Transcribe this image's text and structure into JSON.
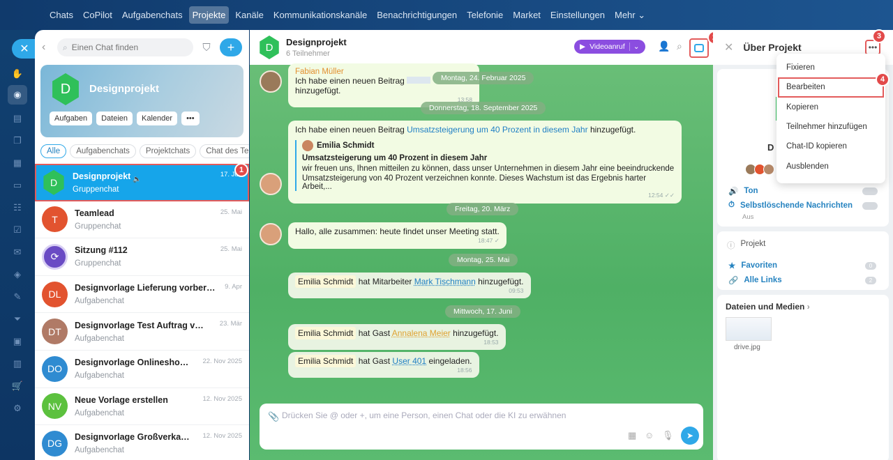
{
  "topnav": [
    "Chats",
    "CoPilot",
    "Aufgabenchats",
    "Projekte",
    "Kanäle",
    "Kommunikationskanäle",
    "Benachrichtigungen",
    "Telefonie",
    "Market",
    "Einstellungen",
    "Mehr ⌄"
  ],
  "sidebar": {
    "search_placeholder": "Einen Chat finden",
    "project": {
      "avatar_letter": "D",
      "name": "Designprojekt",
      "buttons": [
        "Aufgaben",
        "Dateien",
        "Kalender",
        "•••"
      ]
    },
    "filters": [
      "Alle",
      "Aufgabenchats",
      "Projektchats",
      "Chat des Te"
    ],
    "chats": [
      {
        "initials": "D",
        "title": "Designprojekt",
        "subtitle": "Gruppenchat",
        "date": "17. Jun",
        "color": "#2fc05a"
      },
      {
        "initials": "T",
        "title": "Teamlead",
        "subtitle": "Gruppenchat",
        "date": "25. Mai",
        "color": "#e2532f"
      },
      {
        "initials": "",
        "title": "Sitzung #112",
        "subtitle": "Gruppenchat",
        "date": "25. Mai",
        "color": "#6a4bc4"
      },
      {
        "initials": "DL",
        "title": "Designvorlage Lieferung vorbereiten",
        "subtitle": "Aufgabenchat",
        "date": "9. Apr",
        "color": "#e2532f"
      },
      {
        "initials": "DT",
        "title": "Designvorlage Test Auftrag vorbe...",
        "subtitle": "Aufgabenchat",
        "date": "23. Mär",
        "color": "#b07a66"
      },
      {
        "initials": "DO",
        "title": "Designvorlage Onlineshopbe...",
        "subtitle": "Aufgabenchat",
        "date": "22. Nov 2025",
        "color": "#2f8bd1"
      },
      {
        "initials": "NV",
        "title": "Neue Vorlage erstellen",
        "subtitle": "Aufgabenchat",
        "date": "12. Nov 2025",
        "color": "#5cc13e"
      },
      {
        "initials": "DG",
        "title": "Designvorlage Großverkauf v...",
        "subtitle": "Aufgabenchat",
        "date": "12. Nov 2025",
        "color": "#2f8bd1"
      }
    ]
  },
  "chat": {
    "title": "Designprojekt",
    "subtitle": "6 Teilnehmer",
    "avatar_letter": "D",
    "video_label": "Videoanruf",
    "msg1": {
      "author": "Fabian Müller",
      "text_a": "Ich habe einen neuen Beitrag",
      "text_b": "hinzugefügt.",
      "time": "13:58"
    },
    "date1": "Montag, 24. Februar 2025",
    "date2": "Donnerstag, 18. September 2025",
    "msg2": {
      "text_a": "Ich habe einen neuen Beitrag",
      "link": "Umsatzsteigerung um 40 Prozent in diesem Jahr",
      "text_b": "hinzugefügt.",
      "quote_author": "Emilia Schmidt",
      "quote_title": "Umsatzsteigerung um 40 Prozent in diesem Jahr",
      "quote_line1": "wir freuen uns, Ihnen mitteilen zu können, dass unser Unternehmen in diesem Jahr eine beeindruckende",
      "quote_line2": "Umsatzsteigerung von 40 Prozent verzeichnen konnte. Dieses Wachstum ist das Ergebnis harter Arbeit,...",
      "time": "12:54 ✓✓"
    },
    "date3": "Freitag, 20. März",
    "msg3": {
      "text": "Hallo, alle zusammen: heute findet unser Meeting statt.",
      "time": "18:47 ✓"
    },
    "date4": "Montag, 25. Mai",
    "sys1": {
      "name": "Emilia Schmidt",
      "text_a": "hat Mitarbeiter",
      "link": "Mark Tischmann",
      "text_b": "hinzugefügt.",
      "time": "09:53"
    },
    "date5": "Mittwoch, 17. Juni",
    "sys2": {
      "name": "Emilia Schmidt",
      "text_a": "hat Gast",
      "link": "Annalena Meier",
      "text_b": "hinzugefügt.",
      "time": "18:53"
    },
    "sys3": {
      "name": "Emilia Schmidt",
      "text_a": "hat Gast",
      "link": "User 401",
      "text_b": "eingeladen.",
      "time": "18:56"
    },
    "input_placeholder": "Drücken Sie @ oder +, um eine Person, einen Chat oder die KI zu erwähnen"
  },
  "rpanel": {
    "title": "Über Projekt",
    "name_initial": "D",
    "ton": "Ton",
    "selfdelete": "Selbstlöschende Nachrichten",
    "selfdelete_state": "Aus",
    "projekt": "Projekt",
    "favoriten": "Favoriten",
    "favoriten_count": "0",
    "links": "Alle Links",
    "links_count": "2",
    "files_title": "Dateien und Medien",
    "file_name": "drive.jpg"
  },
  "menu": [
    "Fixieren",
    "Bearbeiten",
    "Kopieren",
    "Teilnehmer hinzufügen",
    "Chat-ID kopieren",
    "Ausblenden"
  ],
  "badges": [
    "1",
    "2",
    "3",
    "4"
  ]
}
